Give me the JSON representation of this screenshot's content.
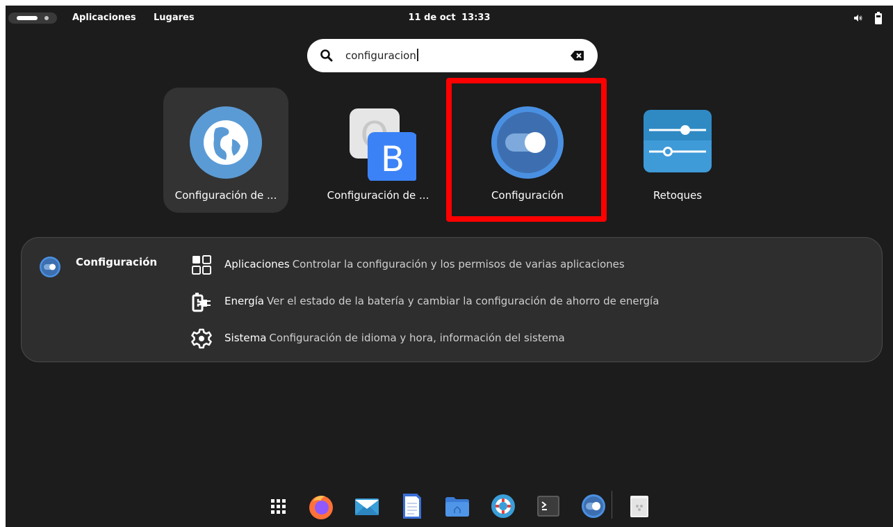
{
  "topbar": {
    "activities_icon": "activities-pill-icon",
    "apps_menu": "Aplicaciones",
    "places_menu": "Lugares",
    "clock_date": "11 de oct",
    "clock_time": "13:33",
    "volume_icon": "volume-icon",
    "battery_icon": "battery-icon"
  },
  "search": {
    "value": "configuracion",
    "search_icon": "search-icon",
    "clear_icon": "clear-text-icon"
  },
  "apps": [
    {
      "label": "Configuración de ...",
      "icon": "network-globe-icon",
      "selected": true
    },
    {
      "label": "Configuración de ...",
      "icon": "input-method-icon",
      "selected": false
    },
    {
      "label": "Configuración",
      "icon": "settings-toggle-icon",
      "selected": false
    },
    {
      "label": "Retoques",
      "icon": "tweaks-sliders-icon",
      "selected": false
    }
  ],
  "highlight_color": "#ff0000",
  "provider": {
    "name": "Configuración",
    "icon": "settings-toggle-icon",
    "results": [
      {
        "title": "Aplicaciones",
        "description": "Controlar la configuración y los permisos de varias aplicaciones",
        "icon": "applications-grid-icon"
      },
      {
        "title": "Energía",
        "description": "Ver el estado de la batería y cambiar la configuración de ahorro de energía",
        "icon": "power-plug-icon"
      },
      {
        "title": "Sistema",
        "description": "Configuración de idioma y hora, información del sistema",
        "icon": "system-gear-icon"
      }
    ]
  },
  "dock": {
    "items": [
      "app-grid-icon",
      "firefox-icon",
      "mail-icon",
      "text-editor-icon",
      "files-icon",
      "help-icon",
      "terminal-icon",
      "settings-icon",
      "trash-icon"
    ]
  }
}
